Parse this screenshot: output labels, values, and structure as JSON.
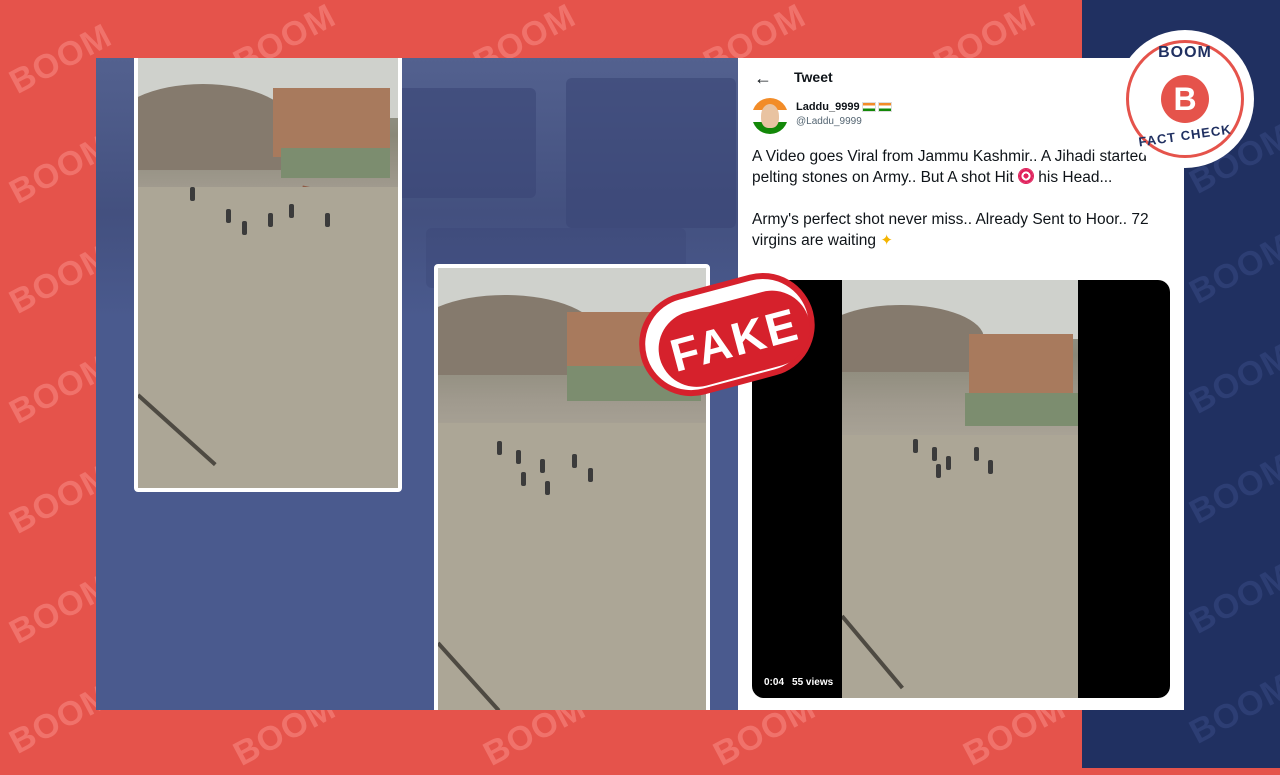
{
  "watermark": "BOOM",
  "tweet": {
    "header_title": "Tweet",
    "back_icon": "back-arrow-icon",
    "display_name": "Laddu_9999",
    "handle": "@Laddu_9999",
    "text_line1": "A Video goes Viral from Jammu Kashmir..  A Jihadi started pelting stones on Army.. But A shot Hit",
    "text_line1b": "his Head...",
    "text_line2": "Army's perfect shot never miss..  Already Sent to Hoor.. 72 virgins are waiting",
    "video_time": "0:04",
    "video_views": "55 views"
  },
  "stamp": {
    "label": "FAKE"
  },
  "logo": {
    "top": "BOOM",
    "letter": "B",
    "bottom": "FACT CHECK"
  },
  "colors": {
    "red": "#e5534b",
    "navy": "#203061",
    "stamp_red": "#d6212c"
  }
}
